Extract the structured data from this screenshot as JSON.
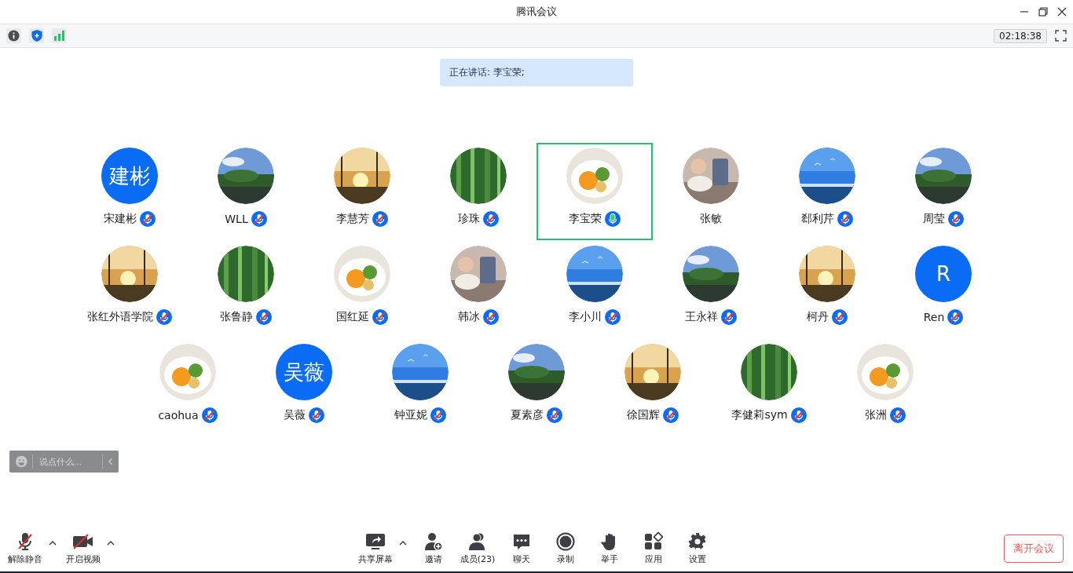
{
  "window": {
    "title": "腾讯会议"
  },
  "info_bar": {
    "timer": "02:18:38"
  },
  "speaking_banner": "正在讲话: 李宝荣;",
  "participants": [
    [
      {
        "name": "宋建彬",
        "avatar": {
          "kind": "initials",
          "text": "建彬"
        },
        "audio": true,
        "muted": true,
        "selected": false
      },
      {
        "name": "WLL",
        "audio": true,
        "muted": true,
        "selected": false
      },
      {
        "name": "李慧芳",
        "audio": true,
        "muted": true,
        "selected": false
      },
      {
        "name": "珍珠",
        "audio": true,
        "muted": true,
        "selected": false
      },
      {
        "name": "李宝荣",
        "audio": true,
        "muted": false,
        "selected": true
      },
      {
        "name": "张敏",
        "audio": false,
        "selected": false
      },
      {
        "name": "郄利芹",
        "audio": true,
        "muted": true,
        "selected": false
      },
      {
        "name": "周莹",
        "audio": true,
        "muted": true,
        "selected": false
      }
    ],
    [
      {
        "name": "张红外语学院",
        "audio": true,
        "muted": true,
        "selected": false
      },
      {
        "name": "张鲁静",
        "audio": true,
        "muted": true,
        "selected": false
      },
      {
        "name": "国红延",
        "audio": true,
        "muted": true,
        "selected": false
      },
      {
        "name": "韩冰",
        "audio": true,
        "muted": true,
        "selected": false
      },
      {
        "name": "李小川",
        "audio": true,
        "muted": true,
        "selected": false
      },
      {
        "name": "王永祥",
        "audio": true,
        "muted": true,
        "selected": false
      },
      {
        "name": "柯丹",
        "audio": true,
        "muted": true,
        "selected": false
      },
      {
        "name": "Ren",
        "avatar": {
          "kind": "initials",
          "text": "R"
        },
        "audio": true,
        "muted": true,
        "selected": false
      }
    ],
    [
      {
        "name": "caohua",
        "audio": true,
        "muted": true,
        "selected": false
      },
      {
        "name": "吴薇",
        "avatar": {
          "kind": "initials",
          "text": "吴薇"
        },
        "audio": true,
        "muted": true,
        "selected": false
      },
      {
        "name": "钟亚妮",
        "audio": true,
        "muted": true,
        "selected": false
      },
      {
        "name": "夏素彦",
        "audio": true,
        "muted": true,
        "selected": false
      },
      {
        "name": "徐国辉",
        "audio": true,
        "muted": true,
        "selected": false
      },
      {
        "name": "李健莉sym",
        "audio": true,
        "muted": true,
        "selected": false
      },
      {
        "name": "张洲",
        "audio": true,
        "muted": true,
        "selected": false
      }
    ]
  ],
  "chat_input": {
    "placeholder": "说点什么..."
  },
  "toolbar": {
    "left": [
      {
        "kind": "unmute",
        "label": "解除静音",
        "caret": true
      },
      {
        "kind": "video",
        "label": "开启视频",
        "caret": true
      }
    ],
    "center": [
      {
        "kind": "share",
        "label": "共享屏幕",
        "caret": true
      },
      {
        "kind": "invite",
        "label": "邀请",
        "caret": false
      },
      {
        "kind": "members",
        "label": "成员(23)",
        "caret": false
      },
      {
        "kind": "chat",
        "label": "聊天",
        "caret": false
      },
      {
        "kind": "record",
        "label": "录制",
        "caret": false
      },
      {
        "kind": "hand",
        "label": "举手",
        "caret": false
      },
      {
        "kind": "apps",
        "label": "应用",
        "caret": false
      },
      {
        "kind": "settings",
        "label": "设置",
        "caret": false
      }
    ],
    "leave_button": "离开会议"
  }
}
